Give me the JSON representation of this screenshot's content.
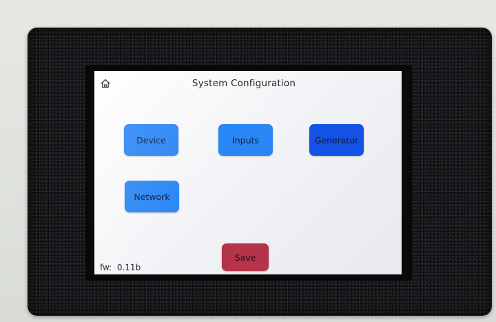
{
  "header": {
    "title": "System Configuration",
    "home_icon": "home-icon"
  },
  "menu": {
    "device_label": "Device",
    "inputs_label": "Inputs",
    "generator_label": "Generator",
    "network_label": "Network"
  },
  "footer": {
    "firmware_label": "fw:  0.11b",
    "save_label": "Save"
  },
  "colors": {
    "tile_blue": "#2a86f4",
    "tile_deep_blue": "#1452e6",
    "save_red": "#b5344a",
    "bezel": "#16171a"
  }
}
